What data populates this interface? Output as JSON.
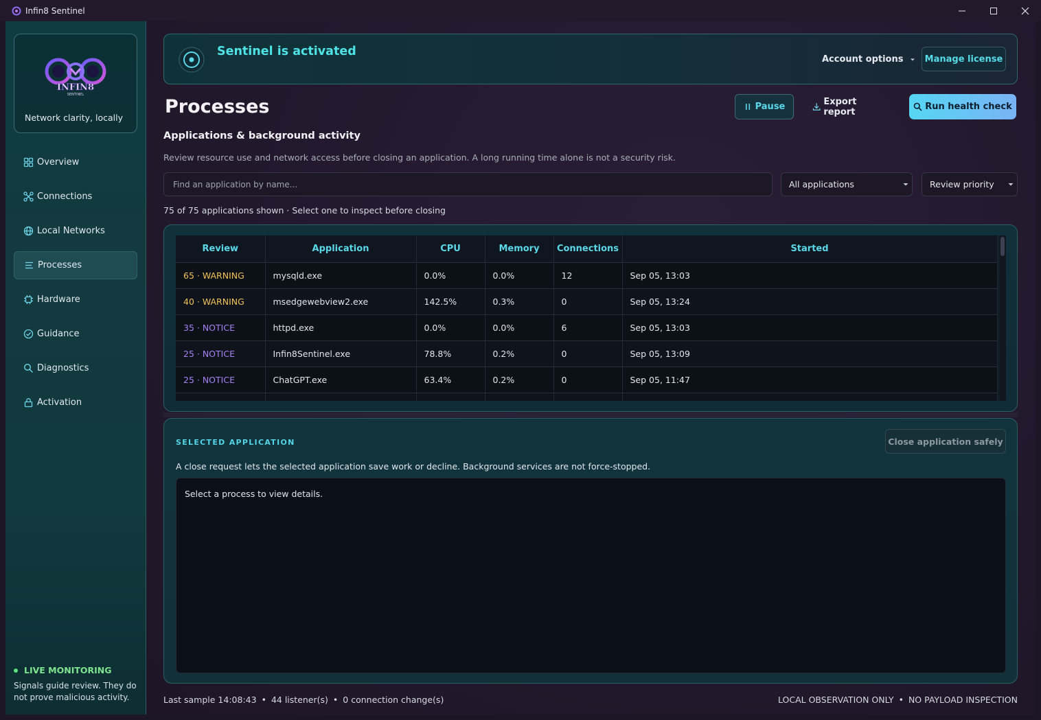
{
  "window": {
    "title": "Infin8 Sentinel",
    "controls": [
      "minimize-icon",
      "maximize-icon",
      "close-icon"
    ]
  },
  "sidebar": {
    "brand": {
      "logo_text": "INFIN8",
      "logo_subtext": "SENTINEL",
      "tagline": "Network clarity, locally"
    },
    "items": [
      {
        "label": "Overview",
        "icon": "grid-icon",
        "active": false
      },
      {
        "label": "Connections",
        "icon": "network-nodes-icon",
        "active": false
      },
      {
        "label": "Local Networks",
        "icon": "globe-icon",
        "active": false
      },
      {
        "label": "Processes",
        "icon": "list-icon",
        "active": true
      },
      {
        "label": "Hardware",
        "icon": "chip-icon",
        "active": false
      },
      {
        "label": "Guidance",
        "icon": "check-circle-icon",
        "active": false
      },
      {
        "label": "Diagnostics",
        "icon": "search-icon",
        "active": false
      },
      {
        "label": "Activation",
        "icon": "lock-icon",
        "active": false
      }
    ],
    "live": {
      "title": "LIVE MONITORING",
      "text": "Signals guide review. They do not prove malicious activity."
    }
  },
  "banner": {
    "title": "Sentinel is activated",
    "account_options": "Account options",
    "manage_license": "Manage license"
  },
  "header": {
    "title": "Processes",
    "pause": "Pause",
    "export": "Export report",
    "health": "Run health check",
    "subtitle": "Applications & background activity",
    "description": "Review resource use and network access before closing an application. A long running time alone is not a security risk."
  },
  "filters": {
    "search_placeholder": "Find an application by name...",
    "scope": "All applications",
    "sort": "Review priority",
    "count": "75 of 75 applications shown · Select one to inspect before closing"
  },
  "table": {
    "columns": [
      "Review",
      "Application",
      "CPU",
      "Memory",
      "Connections",
      "Started"
    ],
    "rows": [
      {
        "score": "65",
        "severity": "WARNING",
        "app": "mysqld.exe",
        "cpu": "0.0%",
        "memory": "0.0%",
        "connections": "12",
        "started": "Sep 05, 13:03"
      },
      {
        "score": "40",
        "severity": "WARNING",
        "app": "msedgewebview2.exe",
        "cpu": "142.5%",
        "memory": "0.3%",
        "connections": "0",
        "started": "Sep 05, 13:24"
      },
      {
        "score": "35",
        "severity": "NOTICE",
        "app": "httpd.exe",
        "cpu": "0.0%",
        "memory": "0.0%",
        "connections": "6",
        "started": "Sep 05, 13:03"
      },
      {
        "score": "25",
        "severity": "NOTICE",
        "app": "Infin8Sentinel.exe",
        "cpu": "78.8%",
        "memory": "0.2%",
        "connections": "0",
        "started": "Sep 05, 13:09"
      },
      {
        "score": "25",
        "severity": "NOTICE",
        "app": "ChatGPT.exe",
        "cpu": "63.4%",
        "memory": "0.2%",
        "connections": "0",
        "started": "Sep 05, 11:47"
      }
    ],
    "colors": {
      "warning": "#f2c25a",
      "notice": "#a782f2"
    }
  },
  "detail": {
    "label": "SELECTED APPLICATION",
    "close_button": "Close application safely",
    "description": "A close request lets the selected application save work or decline. Background services are not force-stopped.",
    "placeholder": "Select a process to view details."
  },
  "footer": {
    "last_sample": "Last sample 14:08:43",
    "listeners": "44 listener(s)",
    "changes": "0 connection change(s)",
    "local_only": "LOCAL OBSERVATION ONLY",
    "no_payload": "NO PAYLOAD INSPECTION"
  }
}
